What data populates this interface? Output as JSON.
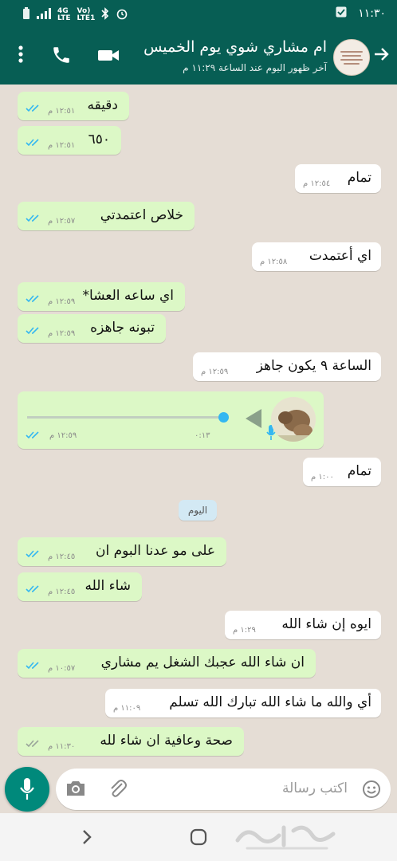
{
  "status_bar": {
    "time": "١١:٣٠",
    "network_top": "4G",
    "network_bottom": "LTE",
    "volte_top": "Vo)",
    "volte_bottom": "LTE1"
  },
  "header": {
    "title": "ام مشاري شوي يوم الخميس",
    "subtitle": "آخر ظهور اليوم عند الساعة ١١:٢٩ م"
  },
  "messages": [
    {
      "text": "دقيقه",
      "time": "١٢:٥١ م"
    },
    {
      "text": "٦٥٠",
      "time": "١٢:٥١ م"
    },
    {
      "text": "تمام",
      "time": "١٢:٥٤ م"
    },
    {
      "text": "خلاص  اعتمدتي",
      "time": "١٢:٥٧ م"
    },
    {
      "text": "اي أعتمدت",
      "time": "١٢:٥٨ م"
    },
    {
      "text": "اي ساعه العشا*",
      "time": "١٢:٥٩ م"
    },
    {
      "text": "تبونه جاهزه",
      "time": "١٢:٥٩ م"
    },
    {
      "text": "الساعة ٩ يكون جاهز",
      "time": "١٢:٥٩ م"
    },
    {
      "text": "تمام",
      "time": "١:٠٠ م"
    },
    {
      "text": "على مو عدنا البوم ان",
      "time": "١٢:٤٥ م"
    },
    {
      "text": "شاء الله",
      "time": "١٢:٤٥ م"
    },
    {
      "text": "ايوه إن شاء الله",
      "time": "١:٢٩ م"
    },
    {
      "text": "ان شاء الله  عجبك الشغل يم مشاري",
      "time": "١٠:٥٧ م"
    },
    {
      "text": "أي والله ما شاء الله تبارك الله تسلم",
      "time": "١١:٠٩ م"
    },
    {
      "text": "صحة وعافية ان شاء لله",
      "time": "١١:٣٠ م"
    }
  ],
  "voice_note": {
    "duration": "٠:١٣",
    "time": "١٢:٥٩ م",
    "progress": 1.0
  },
  "date_divider": "اليوم",
  "composer": {
    "placeholder": "اكتب رسالة"
  },
  "colors": {
    "header": "#075e54",
    "outgoing": "#dcf8c6",
    "incoming": "#ffffff",
    "ticks": "#34b7f1",
    "fab": "#00897b"
  },
  "icons": [
    "more-vert-icon",
    "phone-icon",
    "video-camera-icon",
    "back-arrow-icon",
    "camera-icon",
    "paperclip-icon",
    "emoji-icon",
    "mic-icon",
    "nav-back-icon",
    "nav-home-icon"
  ]
}
